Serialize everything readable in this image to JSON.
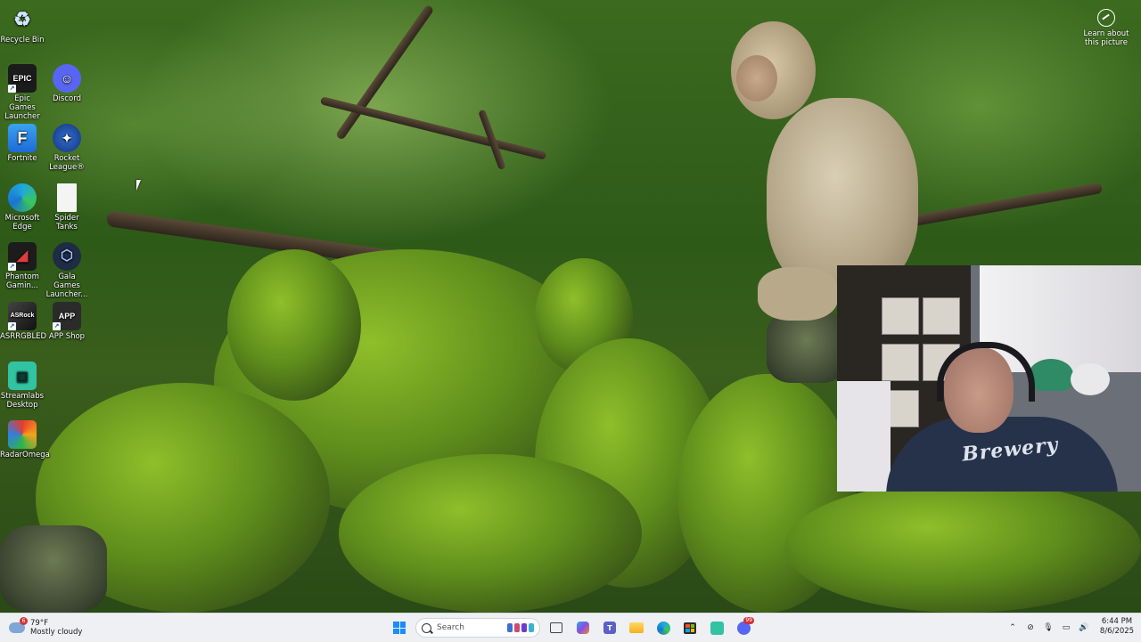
{
  "desktop": {
    "icons": [
      {
        "label": "Recycle Bin",
        "icon": "recycle-bin-icon"
      },
      {
        "label": "Epic Games Launcher",
        "icon": "epic-games-icon"
      },
      {
        "label": "Discord",
        "icon": "discord-icon"
      },
      {
        "label": "Fortnite",
        "icon": "fortnite-icon"
      },
      {
        "label": "Rocket League®",
        "icon": "rocket-league-icon"
      },
      {
        "label": "Microsoft Edge",
        "icon": "edge-icon"
      },
      {
        "label": "Spider Tanks",
        "icon": "file-icon"
      },
      {
        "label": "Phantom Gamin...",
        "icon": "phantom-gaming-icon"
      },
      {
        "label": "Gala Games Launcher...",
        "icon": "gala-games-icon"
      },
      {
        "label": "ASRRGBLED",
        "icon": "asrrgbled-icon"
      },
      {
        "label": "APP Shop",
        "icon": "app-shop-icon"
      },
      {
        "label": "Streamlabs Desktop",
        "icon": "streamlabs-icon"
      },
      {
        "label": "RadarOmega",
        "icon": "radaromega-icon"
      }
    ],
    "learn_about": "Learn about this picture"
  },
  "webcam": {
    "shirt_text": "Brewery"
  },
  "taskbar": {
    "weather": {
      "temp": "79°F",
      "condition": "Mostly cloudy",
      "badge": "6"
    },
    "search_placeholder": "Search",
    "apps": [
      "start-icon",
      "task-view-icon",
      "copilot-icon",
      "teams-icon",
      "file-explorer-icon",
      "edge-icon",
      "store-icon",
      "streamlabs-icon",
      "discord-icon"
    ],
    "discord_badge": "99",
    "clock": {
      "time": "6:44 PM",
      "date": "8/6/2025"
    }
  },
  "colors": {
    "taskbar_bg": "#eef0f4",
    "accent": "#0078d4"
  }
}
